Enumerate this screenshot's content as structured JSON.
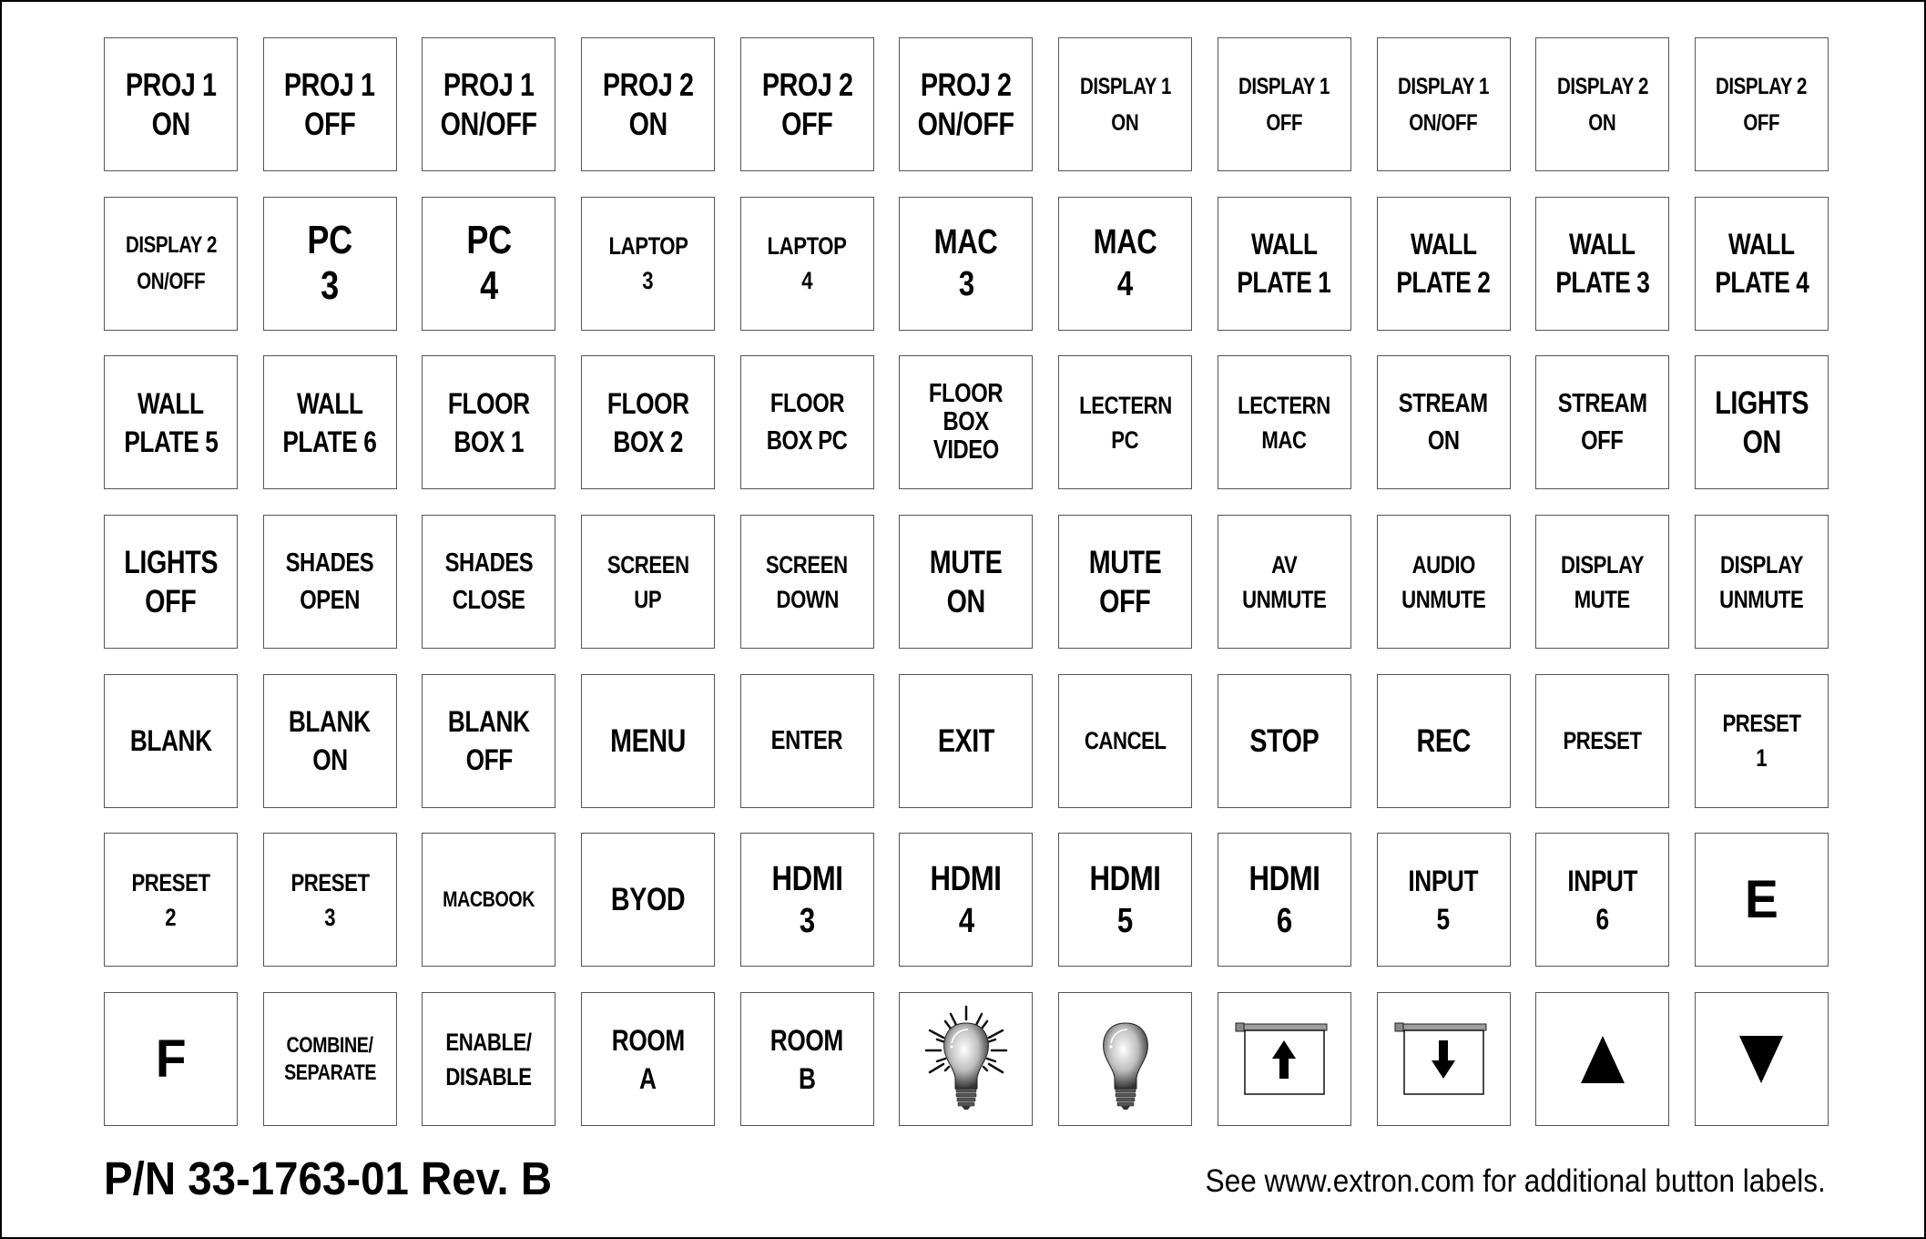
{
  "sheet": {
    "part_number": "P/N 33-1763-01 Rev. B",
    "note": "See www.extron.com for additional button labels."
  },
  "rows": [
    [
      {
        "lines": [
          "PROJ 1",
          "ON"
        ],
        "size": "m"
      },
      {
        "lines": [
          "PROJ 1",
          "OFF"
        ],
        "size": "m"
      },
      {
        "lines": [
          "PROJ 1",
          "ON/OFF"
        ],
        "size": "m"
      },
      {
        "lines": [
          "PROJ 2",
          "ON"
        ],
        "size": "m"
      },
      {
        "lines": [
          "PROJ 2",
          "OFF"
        ],
        "size": "m"
      },
      {
        "lines": [
          "PROJ 2",
          "ON/OFF"
        ],
        "size": "m"
      },
      {
        "lines": [
          "DISPLAY 1",
          "ON"
        ],
        "size": "xxs"
      },
      {
        "lines": [
          "DISPLAY 1",
          "OFF"
        ],
        "size": "xxs"
      },
      {
        "lines": [
          "DISPLAY 1",
          "ON/OFF"
        ],
        "size": "xxs"
      },
      {
        "lines": [
          "DISPLAY 2",
          "ON"
        ],
        "size": "xxs"
      },
      {
        "lines": [
          "DISPLAY 2",
          "OFF"
        ],
        "size": "xxs"
      }
    ],
    [
      {
        "lines": [
          "DISPLAY 2",
          "ON/OFF"
        ],
        "size": "xxs"
      },
      {
        "lines": [
          "PC",
          "3"
        ],
        "size": "xl"
      },
      {
        "lines": [
          "PC",
          "4"
        ],
        "size": "xl"
      },
      {
        "lines": [
          "LAPTOP",
          "3"
        ],
        "size": "xs"
      },
      {
        "lines": [
          "LAPTOP",
          "4"
        ],
        "size": "xs"
      },
      {
        "lines": [
          "MAC",
          "3"
        ],
        "size": "l"
      },
      {
        "lines": [
          "MAC",
          "4"
        ],
        "size": "l"
      },
      {
        "lines": [
          "WALL",
          "PLATE 1"
        ],
        "size": "ms"
      },
      {
        "lines": [
          "WALL",
          "PLATE 2"
        ],
        "size": "ms"
      },
      {
        "lines": [
          "WALL",
          "PLATE 3"
        ],
        "size": "ms"
      },
      {
        "lines": [
          "WALL",
          "PLATE 4"
        ],
        "size": "ms"
      }
    ],
    [
      {
        "lines": [
          "WALL",
          "PLATE 5"
        ],
        "size": "ms"
      },
      {
        "lines": [
          "WALL",
          "PLATE 6"
        ],
        "size": "ms"
      },
      {
        "lines": [
          "FLOOR",
          "BOX 1"
        ],
        "size": "ms"
      },
      {
        "lines": [
          "FLOOR",
          "BOX 2"
        ],
        "size": "ms"
      },
      {
        "lines": [
          "FLOOR",
          "BOX PC"
        ],
        "size": "s"
      },
      {
        "lines": [
          "FLOOR",
          "BOX",
          "VIDEO"
        ],
        "size": "tiny3"
      },
      {
        "lines": [
          "LECTERN",
          "PC"
        ],
        "size": "xs"
      },
      {
        "lines": [
          "LECTERN",
          "MAC"
        ],
        "size": "xs"
      },
      {
        "lines": [
          "STREAM",
          "ON"
        ],
        "size": "s"
      },
      {
        "lines": [
          "STREAM",
          "OFF"
        ],
        "size": "s"
      },
      {
        "lines": [
          "LIGHTS",
          "ON"
        ],
        "size": "m"
      }
    ],
    [
      {
        "lines": [
          "LIGHTS",
          "OFF"
        ],
        "size": "m"
      },
      {
        "lines": [
          "SHADES",
          "OPEN"
        ],
        "size": "s"
      },
      {
        "lines": [
          "SHADES",
          "CLOSE"
        ],
        "size": "s"
      },
      {
        "lines": [
          "SCREEN",
          "UP"
        ],
        "size": "xs"
      },
      {
        "lines": [
          "SCREEN",
          "DOWN"
        ],
        "size": "xs"
      },
      {
        "lines": [
          "MUTE",
          "ON"
        ],
        "size": "m"
      },
      {
        "lines": [
          "MUTE",
          "OFF"
        ],
        "size": "m"
      },
      {
        "lines": [
          "AV",
          "UNMUTE"
        ],
        "size": "xs"
      },
      {
        "lines": [
          "AUDIO",
          "UNMUTE"
        ],
        "size": "xs"
      },
      {
        "lines": [
          "DISPLAY",
          "MUTE"
        ],
        "size": "xs"
      },
      {
        "lines": [
          "DISPLAY",
          "UNMUTE"
        ],
        "size": "xs"
      }
    ],
    [
      {
        "lines": [
          "BLANK"
        ],
        "size": "ms"
      },
      {
        "lines": [
          "BLANK",
          "ON"
        ],
        "size": "ms"
      },
      {
        "lines": [
          "BLANK",
          "OFF"
        ],
        "size": "ms"
      },
      {
        "lines": [
          "MENU"
        ],
        "size": "m"
      },
      {
        "lines": [
          "ENTER"
        ],
        "size": "s"
      },
      {
        "lines": [
          "EXIT"
        ],
        "size": "m"
      },
      {
        "lines": [
          "CANCEL"
        ],
        "size": "xs"
      },
      {
        "lines": [
          "STOP"
        ],
        "size": "m"
      },
      {
        "lines": [
          "REC"
        ],
        "size": "m"
      },
      {
        "lines": [
          "PRESET"
        ],
        "size": "xs"
      },
      {
        "lines": [
          "PRESET",
          "1"
        ],
        "size": "xs"
      }
    ],
    [
      {
        "lines": [
          "PRESET",
          "2"
        ],
        "size": "xs"
      },
      {
        "lines": [
          "PRESET",
          "3"
        ],
        "size": "xs"
      },
      {
        "lines": [
          "MACBOOK"
        ],
        "size": "tiny"
      },
      {
        "lines": [
          "BYOD"
        ],
        "size": "m"
      },
      {
        "lines": [
          "HDMI",
          "3"
        ],
        "size": "l"
      },
      {
        "lines": [
          "HDMI",
          "4"
        ],
        "size": "l"
      },
      {
        "lines": [
          "HDMI",
          "5"
        ],
        "size": "l"
      },
      {
        "lines": [
          "HDMI",
          "6"
        ],
        "size": "l"
      },
      {
        "lines": [
          "INPUT",
          "5"
        ],
        "size": "ms"
      },
      {
        "lines": [
          "INPUT",
          "6"
        ],
        "size": "ms"
      },
      {
        "lines": [
          "E"
        ],
        "size": "huge"
      }
    ],
    [
      {
        "lines": [
          "F"
        ],
        "size": "huge"
      },
      {
        "lines": [
          "COMBINE/",
          "SEPARATE"
        ],
        "size": "tiny"
      },
      {
        "lines": [
          "ENABLE/",
          "DISABLE"
        ],
        "size": "xs"
      },
      {
        "lines": [
          "ROOM",
          "A"
        ],
        "size": "ms"
      },
      {
        "lines": [
          "ROOM",
          "B"
        ],
        "size": "ms"
      },
      {
        "icon": "light-bulb-on-icon"
      },
      {
        "icon": "light-bulb-off-icon"
      },
      {
        "icon": "screen-up-icon"
      },
      {
        "icon": "screen-down-icon"
      },
      {
        "icon": "triangle-up-icon"
      },
      {
        "icon": "triangle-down-icon"
      }
    ]
  ]
}
